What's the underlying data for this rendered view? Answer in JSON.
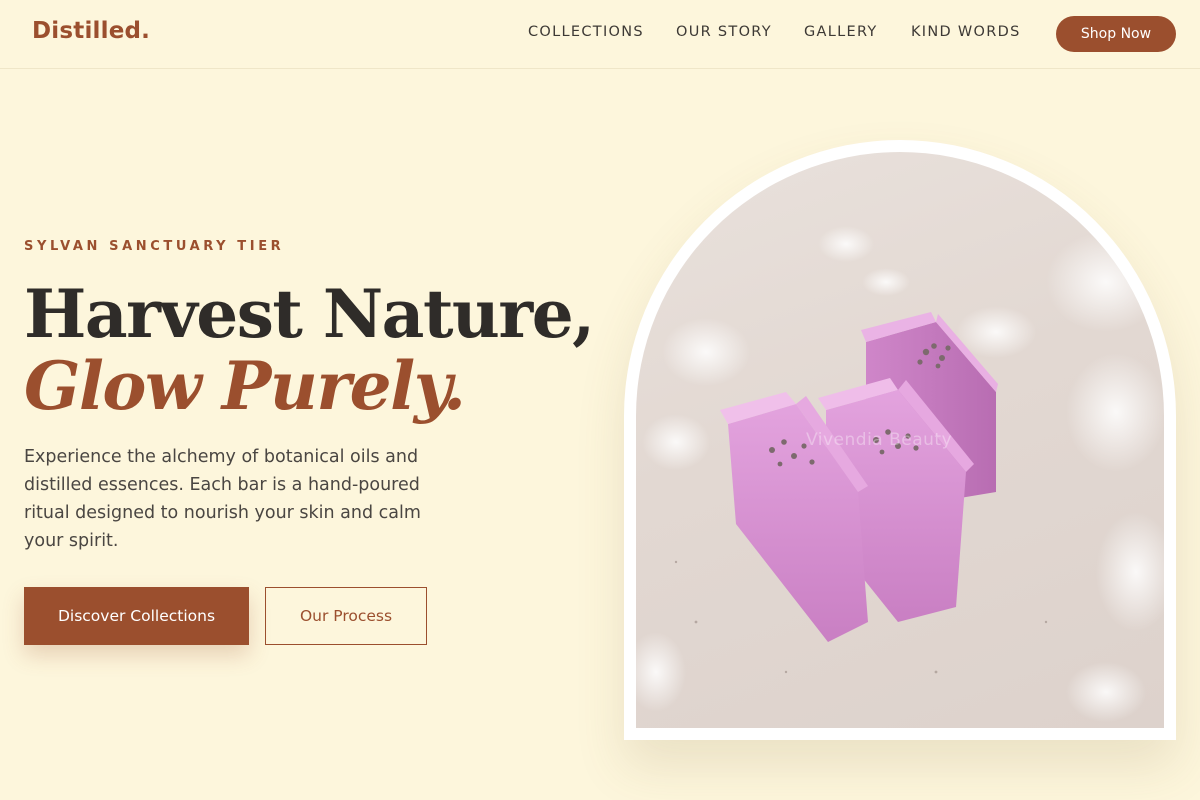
{
  "brand": {
    "logo_text": "Distilled."
  },
  "nav": {
    "items": [
      {
        "label": "COLLECTIONS"
      },
      {
        "label": "OUR STORY"
      },
      {
        "label": "GALLERY"
      },
      {
        "label": "KIND WORDS"
      }
    ],
    "cta_label": "Shop Now"
  },
  "hero": {
    "eyebrow": "SYLVAN SANCTUARY TIER",
    "headline_line1": "Harvest Nature,",
    "headline_line2": "Glow Purely.",
    "description": "Experience the alchemy of botanical oils and distilled essences. Each bar is a hand-poured ritual designed to nourish your skin and calm your spirit.",
    "primary_cta": "Discover Collections",
    "secondary_cta": "Our Process"
  },
  "image": {
    "subject": "lavender-soap-bars",
    "watermark_text": "Vivendia Beauty"
  },
  "colors": {
    "background": "#fdf6dc",
    "accent": "#9b4f2e",
    "heading": "#2f2c29",
    "body_text": "#4a4642",
    "soap_pink": "#d58bd0"
  }
}
